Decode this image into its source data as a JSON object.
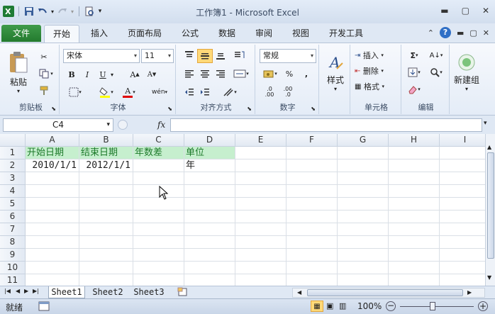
{
  "window": {
    "title": "工作簿1 - Microsoft Excel"
  },
  "ribbon_tabs": [
    "文件",
    "开始",
    "插入",
    "页面布局",
    "公式",
    "数据",
    "审阅",
    "视图",
    "开发工具"
  ],
  "clipboard": {
    "paste": "粘贴",
    "group": "剪贴板"
  },
  "font": {
    "name": "宋体",
    "size": "11",
    "group": "字体",
    "bold": "B",
    "italic": "I",
    "underline": "U",
    "grow": "A",
    "shrink": "A",
    "fontcolor": "A",
    "wen": "wén"
  },
  "alignment": {
    "group": "对齐方式"
  },
  "number": {
    "format": "常规",
    "percent": "%",
    "comma": ",",
    "group": "数字",
    "inc": ".0 .00",
    "dec": ".00 .0"
  },
  "styles": {
    "label": "样式"
  },
  "cells": {
    "insert": "插入",
    "delete": "删除",
    "format": "格式",
    "group": "单元格"
  },
  "editing": {
    "sigma": "Σ",
    "group": "编辑"
  },
  "newgroup": {
    "label": "新建组"
  },
  "formula_bar": {
    "name_box": "C4",
    "fx": "fx",
    "value": ""
  },
  "columns": [
    "A",
    "B",
    "C",
    "D",
    "E",
    "F",
    "G",
    "H",
    "I"
  ],
  "rows": [
    "1",
    "2",
    "3",
    "4",
    "5",
    "6",
    "7",
    "8",
    "9",
    "10",
    "11"
  ],
  "sheet": {
    "r1": [
      "开始日期",
      "结束日期",
      "年数差",
      "单位"
    ],
    "r2": [
      "2010/1/1",
      "2012/1/1",
      "",
      "年"
    ]
  },
  "sheet_tabs": [
    "Sheet1",
    "Sheet2",
    "Sheet3"
  ],
  "status": {
    "mode": "就绪",
    "zoom": "100%"
  }
}
